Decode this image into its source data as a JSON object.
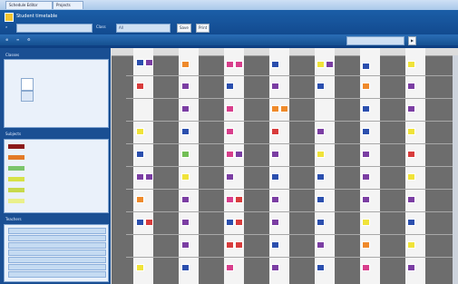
{
  "titlebar": {
    "tabs": [
      "Schedule Editor",
      "Projects"
    ]
  },
  "app": {
    "title": "Student timetable",
    "toolbar": {
      "search_placeholder": "",
      "buttons": [
        "Save",
        "Print"
      ]
    },
    "filter": {
      "label": "Class",
      "value": "All"
    }
  },
  "sidebar": {
    "panel1": {
      "title": "Classes"
    },
    "legend": {
      "title": "Subjects",
      "items": [
        {
          "label": "",
          "color": "#8b1a1a"
        },
        {
          "label": "",
          "color": "#e37a27"
        },
        {
          "label": "",
          "color": "#7bc56b"
        },
        {
          "label": "",
          "color": "#d7e247"
        },
        {
          "label": "",
          "color": "#c7d94b"
        },
        {
          "label": "",
          "color": "#eaf08a"
        }
      ]
    },
    "selector": {
      "title": "Teachers",
      "items": [
        "",
        "",
        "",
        "",
        "",
        "",
        ""
      ]
    }
  },
  "grid": {
    "row_labels": [
      "",
      "",
      "",
      "",
      "",
      "",
      "",
      "",
      "",
      "",
      "",
      "",
      ""
    ],
    "colors": {
      "purple": "#7b3ea3",
      "pink": "#d83f8c",
      "blue": "#2b4fae",
      "yellow": "#f0e33a",
      "orange": "#ef8a2b",
      "red": "#d83c3c",
      "green": "#73bf56"
    }
  }
}
